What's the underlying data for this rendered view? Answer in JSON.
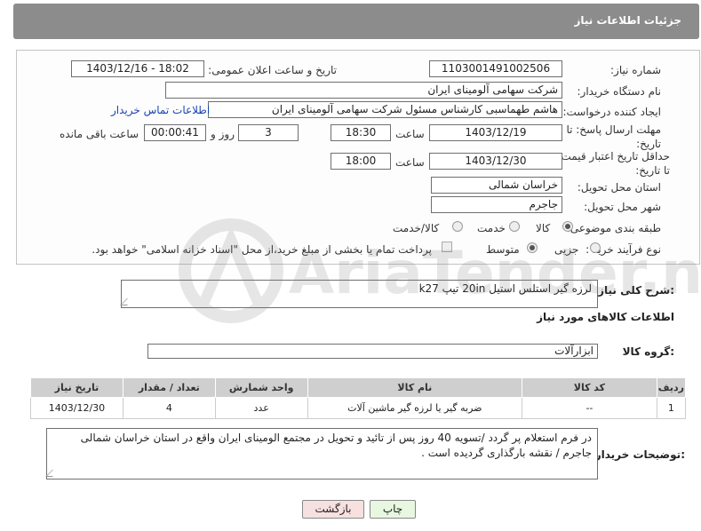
{
  "header": {
    "title": "جزئیات اطلاعات نیاز"
  },
  "form": {
    "need_number_label": "شماره نیاز:",
    "need_number": "1103001491002506",
    "announce_label": "تاریخ و ساعت اعلان عمومی:",
    "announce_value": "1403/12/16 - 18:02",
    "buyer_org_label": "نام دستگاه خریدار:",
    "buyer_org": "شرکت سهامی آلومینای ایران",
    "creator_label": "ایجاد کننده درخواست:",
    "creator": "هاشم طهماسبی کارشناس مسئول شرکت سهامی آلومینای ایران",
    "contact_link": "اطلاعات تماس خریدار",
    "deadline_label": "مهلت ارسال پاسخ: تا تاریخ:",
    "deadline_date": "1403/12/19",
    "time_label": "ساعت",
    "deadline_time": "18:30",
    "days_value": "3",
    "days_label": "روز و",
    "remaining_time": "00:00:41",
    "remaining_label": "ساعت باقی مانده",
    "validity_label": "حداقل تاریخ اعتبار قیمت: تا تاریخ:",
    "validity_date": "1403/12/30",
    "validity_time_label": "ساعت",
    "validity_time": "18:00",
    "province_label": "استان محل تحویل:",
    "province": "خراسان شمالی",
    "city_label": "شهر محل تحویل:",
    "city": "جاجرم",
    "category_label": "طبقه بندی موضوعی:",
    "category_options": [
      "کالا",
      "خدمت",
      "کالا/خدمت"
    ],
    "process_label": "نوع فرآیند خرید :",
    "process_options": [
      "جزیی",
      "متوسط"
    ],
    "payment_note": "پرداخت تمام یا بخشی از مبلغ خرید،از محل \"اسناد خزانه اسلامی\" خواهد بود."
  },
  "summary": {
    "label": "شرح کلی نیاز:",
    "text": "لرزه گیر استلس استیل 20in تیپ k27"
  },
  "goods_section": {
    "title": "اطلاعات کالاهای مورد نیاز",
    "group_label": "گروه کالا:",
    "group_value": "ابزارآلات"
  },
  "table": {
    "headers": [
      "ردیف",
      "کد کالا",
      "نام کالا",
      "واحد شمارش",
      "تعداد / مقدار",
      "تاریخ نیاز"
    ],
    "rows": [
      [
        "1",
        "--",
        "ضربه گیر یا لرزه گیر ماشین آلات",
        "عدد",
        "4",
        "1403/12/30"
      ]
    ]
  },
  "buyer_notes": {
    "label": "توضیحات خریدار:",
    "text": "در فرم استعلام پر گردد /تسویه 40 روز پس از تائید و تحویل در مجتمع الومینای ایران واقع در استان خراسان شمالی جاجرم / نقشه بارگذاری گردیده است ."
  },
  "buttons": {
    "print": "چاپ",
    "back": "بازگشت"
  },
  "watermark": {
    "text": "AriaTender.neT"
  },
  "colors": {
    "header_bg": "#8c8c8c",
    "link": "#1a44b5",
    "back_btn": "#f7e0e0",
    "print_btn": "#e8f7e0"
  }
}
